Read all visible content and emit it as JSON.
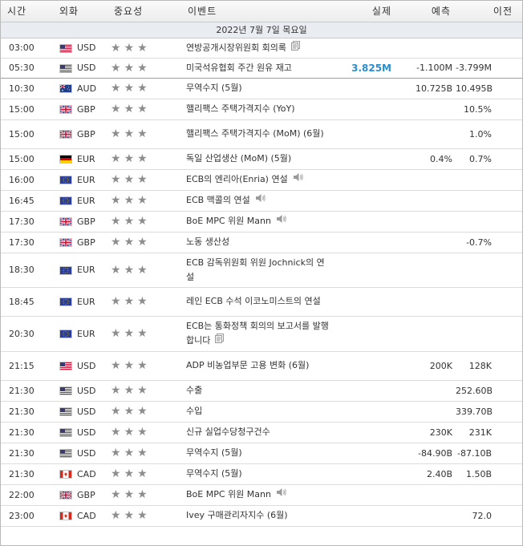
{
  "header": {
    "time": "시간",
    "currency": "외화",
    "importance": "중요성",
    "event": "이벤트",
    "actual": "실제",
    "forecast": "예측",
    "previous": "이전"
  },
  "date_label": "2022년 7월 7일 목요일",
  "colors": {
    "actual_up": "#2a8fd0",
    "star": "#8d8d8d",
    "star_dim": "#cfcfcf"
  },
  "rows": [
    {
      "time": "03:00",
      "flag": "us",
      "currency": "USD",
      "stars": 1,
      "event": "연방공개시장위원회 회의록",
      "icon": "document-icon",
      "actual": "",
      "forecast": "",
      "previous": ""
    },
    {
      "time": "05:30",
      "flag": "us",
      "currency": "USD",
      "stars": 1,
      "event": "미국석유협회 주간 원유 재고",
      "icon": "",
      "actual": "3.825M",
      "forecast": "-1.100M",
      "previous": "-3.799M",
      "hl": true
    },
    {
      "time": "10:30",
      "flag": "au",
      "currency": "AUD",
      "stars": 2,
      "event": "무역수지 (5월)",
      "icon": "",
      "actual": "",
      "forecast": "10.725B",
      "previous": "10.495B"
    },
    {
      "time": "15:00",
      "flag": "gb",
      "currency": "GBP",
      "stars": 2,
      "event": "핼리팩스 주택가격지수 (YoY)",
      "icon": "",
      "actual": "",
      "forecast": "",
      "previous": "10.5%"
    },
    {
      "time": "15:00",
      "flag": "gb",
      "currency": "GBP",
      "stars": 2,
      "event": "핼리팩스 주택가격지수 (MoM) (6월)",
      "icon": "",
      "actual": "",
      "forecast": "",
      "previous": "1.0%"
    },
    {
      "time": "15:00",
      "flag": "de",
      "currency": "EUR",
      "stars": 2,
      "event": "독일 산업생산 (MoM) (5월)",
      "icon": "",
      "actual": "",
      "forecast": "0.4%",
      "previous": "0.7%"
    },
    {
      "time": "16:00",
      "flag": "eu",
      "currency": "EUR",
      "stars": 2,
      "event": "ECB의 엔리아(Enria) 연설",
      "icon": "speaker-icon",
      "actual": "",
      "forecast": "",
      "previous": ""
    },
    {
      "time": "16:45",
      "flag": "eu",
      "currency": "EUR",
      "stars": 2,
      "event": "ECB 맥콜의 연설",
      "icon": "speaker-icon",
      "actual": "",
      "forecast": "",
      "previous": ""
    },
    {
      "time": "17:30",
      "flag": "gb",
      "currency": "GBP",
      "stars": 2,
      "event": "BoE MPC 위원 Mann",
      "icon": "speaker-icon",
      "actual": "",
      "forecast": "",
      "previous": ""
    },
    {
      "time": "17:30",
      "flag": "gb",
      "currency": "GBP",
      "stars": 2,
      "event": "노동 생산성",
      "icon": "",
      "actual": "",
      "forecast": "",
      "previous": "-0.7%"
    },
    {
      "time": "18:30",
      "flag": "eu",
      "currency": "EUR",
      "stars": 2,
      "event": "ECB 감독위원회 위원 Jochnick의 연설",
      "icon": "",
      "actual": "",
      "forecast": "",
      "previous": ""
    },
    {
      "time": "18:45",
      "flag": "eu",
      "currency": "EUR",
      "stars": 2,
      "event": "레인 ECB 수석 이코노미스트의 연설",
      "icon": "",
      "actual": "",
      "forecast": "",
      "previous": ""
    },
    {
      "time": "20:30",
      "flag": "eu",
      "currency": "EUR",
      "stars": 2,
      "event": "ECB는 통화정책 회의의 보고서를 발행합니다",
      "icon": "document-icon",
      "actual": "",
      "forecast": "",
      "previous": ""
    },
    {
      "time": "21:15",
      "flag": "us",
      "currency": "USD",
      "stars": 2,
      "event": "ADP 비농업부문 고용 변화 (6월)",
      "icon": "",
      "actual": "",
      "forecast": "200K",
      "previous": "128K"
    },
    {
      "time": "21:30",
      "flag": "us",
      "currency": "USD",
      "stars": 2,
      "event": "수출",
      "icon": "",
      "actual": "",
      "forecast": "",
      "previous": "252.60B"
    },
    {
      "time": "21:30",
      "flag": "us",
      "currency": "USD",
      "stars": 2,
      "event": "수입",
      "icon": "",
      "actual": "",
      "forecast": "",
      "previous": "339.70B"
    },
    {
      "time": "21:30",
      "flag": "us",
      "currency": "USD",
      "stars": 2,
      "event": "신규 실업수당청구건수",
      "icon": "",
      "actual": "",
      "forecast": "230K",
      "previous": "231K"
    },
    {
      "time": "21:30",
      "flag": "us",
      "currency": "USD",
      "stars": 2,
      "event": "무역수지 (5월)",
      "icon": "",
      "actual": "",
      "forecast": "-84.90B",
      "previous": "-87.10B"
    },
    {
      "time": "21:30",
      "flag": "ca",
      "currency": "CAD",
      "stars": 2,
      "event": "무역수지 (5월)",
      "icon": "",
      "actual": "",
      "forecast": "2.40B",
      "previous": "1.50B"
    },
    {
      "time": "22:00",
      "flag": "gb",
      "currency": "GBP",
      "stars": 2,
      "event": "BoE MPC 위원 Mann",
      "icon": "speaker-icon",
      "actual": "",
      "forecast": "",
      "previous": ""
    },
    {
      "time": "23:00",
      "flag": "ca",
      "currency": "CAD",
      "stars": 2,
      "event": "Ivey 구매관리자지수 (6월)",
      "icon": "",
      "actual": "",
      "forecast": "",
      "previous": "72.0"
    }
  ]
}
